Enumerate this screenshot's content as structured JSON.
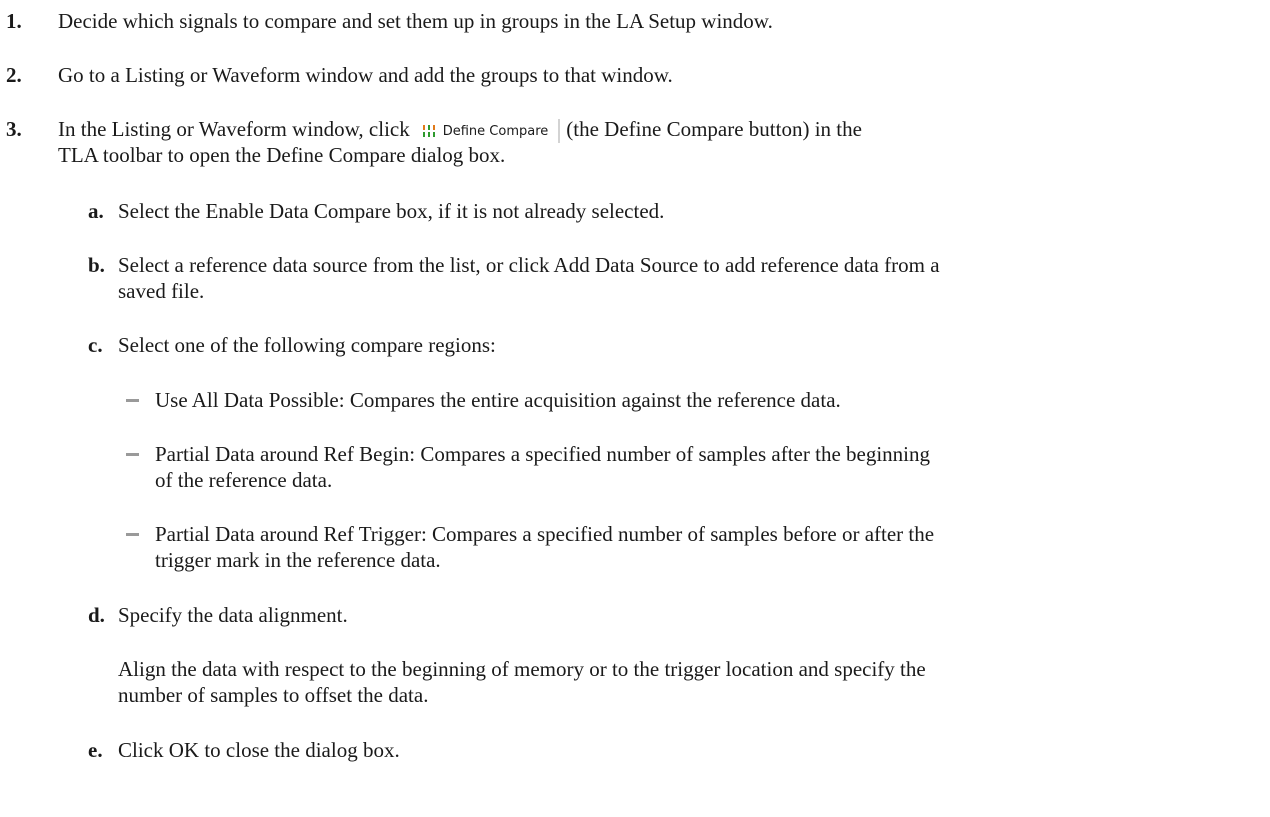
{
  "steps": [
    {
      "number": "1.",
      "text": "Decide which signals to compare and set them up in groups in the LA Setup window."
    },
    {
      "number": "2.",
      "text": "Go to a Listing or Waveform window and add the groups to that window."
    },
    {
      "number": "3.",
      "text_before": "In the Listing or Waveform window, click",
      "button_label": "Define Compare",
      "button_icon": "define-compare-icon",
      "text_after": "(the Define Compare button) in the",
      "text_line2": "TLA toolbar to open the Define Compare dialog box."
    }
  ],
  "substeps": [
    {
      "letter": "a.",
      "text": "Select the Enable Data Compare box, if it is not already selected."
    },
    {
      "letter": "b.",
      "line1": "Select a reference data source from the list, or click Add Data Source to add reference data from a",
      "line2": "saved file."
    },
    {
      "letter": "c.",
      "text": "Select one of the following compare regions:"
    },
    {
      "letter": "d.",
      "text": "Specify the data alignment."
    },
    {
      "letter": "e.",
      "text": "Click OK to close the dialog box."
    }
  ],
  "regions": [
    {
      "text": "Use All Data Possible: Compares the entire acquisition against the reference data."
    },
    {
      "line1": "Partial Data around Ref Begin: Compares a specified number of samples after the beginning",
      "line2": "of the reference data."
    },
    {
      "line1": "Partial Data around Ref Trigger: Compares a specified number of samples before or after the",
      "line2": "trigger mark in the reference data."
    }
  ],
  "alignment_note": {
    "line1": "Align the data with respect to the beginning of memory or to the trigger location and specify the",
    "line2": "number of samples to offset the data."
  },
  "colors": {
    "text": "#1a1a1a",
    "bullet": "#9a9a9a",
    "icon_green": "#2e9a2e",
    "icon_orange": "#e07a1a"
  }
}
